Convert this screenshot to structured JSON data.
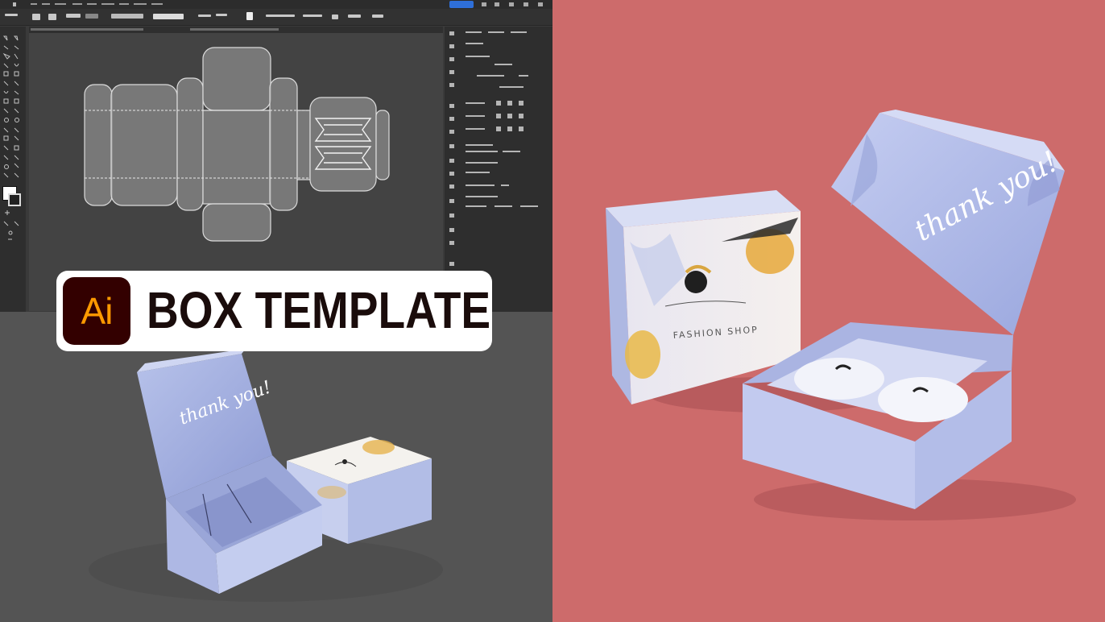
{
  "title_card": {
    "logo_text": "Ai",
    "title": "BOX TEMPLATE"
  },
  "box_mockup": {
    "lid_text": "thank you!",
    "front_text": "FASHION SHOP"
  },
  "colors": {
    "ai_logo_bg": "#330000",
    "ai_logo_text": "#ff9a00",
    "right_bg": "#cd6b6b",
    "left_bottom_bg": "#545454",
    "box_color": "#b8c4ea"
  },
  "icons": [
    "tools-panel",
    "properties-panel",
    "fill-stroke-swatch"
  ]
}
